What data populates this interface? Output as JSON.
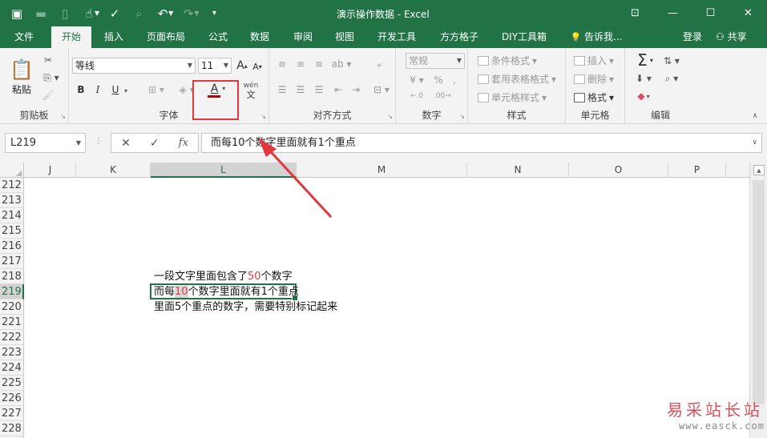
{
  "window": {
    "title": "演示操作数据 - Excel",
    "icons": [
      "save-icon",
      "open-folder-icon",
      "new-file-icon",
      "touch-mode-icon",
      "spelling-icon",
      "preview-icon",
      "undo-icon",
      "redo-icon",
      "customize-icon"
    ],
    "controls": [
      "ribbon-display-icon",
      "minimize-icon",
      "maximize-icon",
      "close-icon"
    ]
  },
  "tabs": [
    {
      "label": "文件"
    },
    {
      "label": "开始"
    },
    {
      "label": "插入"
    },
    {
      "label": "页面布局"
    },
    {
      "label": "公式"
    },
    {
      "label": "数据"
    },
    {
      "label": "审阅"
    },
    {
      "label": "视图"
    },
    {
      "label": "开发工具"
    },
    {
      "label": "方方格子"
    },
    {
      "label": "DIY工具箱"
    },
    {
      "label": "告诉我..."
    }
  ],
  "account": {
    "login": "登录",
    "share": "共享"
  },
  "ribbon": {
    "clipboard": {
      "label": "剪贴板",
      "paste": "粘贴"
    },
    "font": {
      "label": "字体",
      "name": "等线",
      "size": "11",
      "grow": "A",
      "shrink": "A",
      "bold": "B",
      "italic": "I",
      "underline": "U",
      "font_color": "A",
      "phonetic": "wén",
      "phonetic_sub": "文"
    },
    "alignment": {
      "label": "对齐方式"
    },
    "number": {
      "label": "数字",
      "format": "常规"
    },
    "styles": {
      "label": "样式",
      "conditional": "条件格式",
      "table": "套用表格格式",
      "cell_styles": "单元格样式"
    },
    "cells": {
      "label": "单元格",
      "insert": "插入",
      "delete": "删除",
      "format": "格式"
    },
    "editing": {
      "label": "编辑"
    }
  },
  "formula_bar": {
    "name_box": "L219",
    "cancel": "✕",
    "enter": "✓",
    "fx": "fx",
    "content": "而每10个数字里面就有1个重点"
  },
  "columns": [
    "J",
    "K",
    "L",
    "M",
    "N",
    "O",
    "P"
  ],
  "selected_column": "L",
  "rows": [
    "212",
    "213",
    "214",
    "215",
    "216",
    "217",
    "218",
    "219",
    "220",
    "221",
    "222",
    "223",
    "224",
    "225",
    "226",
    "227",
    "228"
  ],
  "selected_row": "219",
  "cells": {
    "r218": {
      "a": "一段文字里面包含了",
      "b": "50",
      "c": "个数字"
    },
    "r219": {
      "a": "而每",
      "b": "10",
      "c": "个数字里面就有1个重点"
    },
    "r220": {
      "a": "里面5个重点的数字，需要特别标记起来"
    }
  },
  "highlight_color": "#e0383e",
  "accent_color": "#217346",
  "watermark": {
    "line1": "易采站长站",
    "line2": "www.easck.com"
  }
}
